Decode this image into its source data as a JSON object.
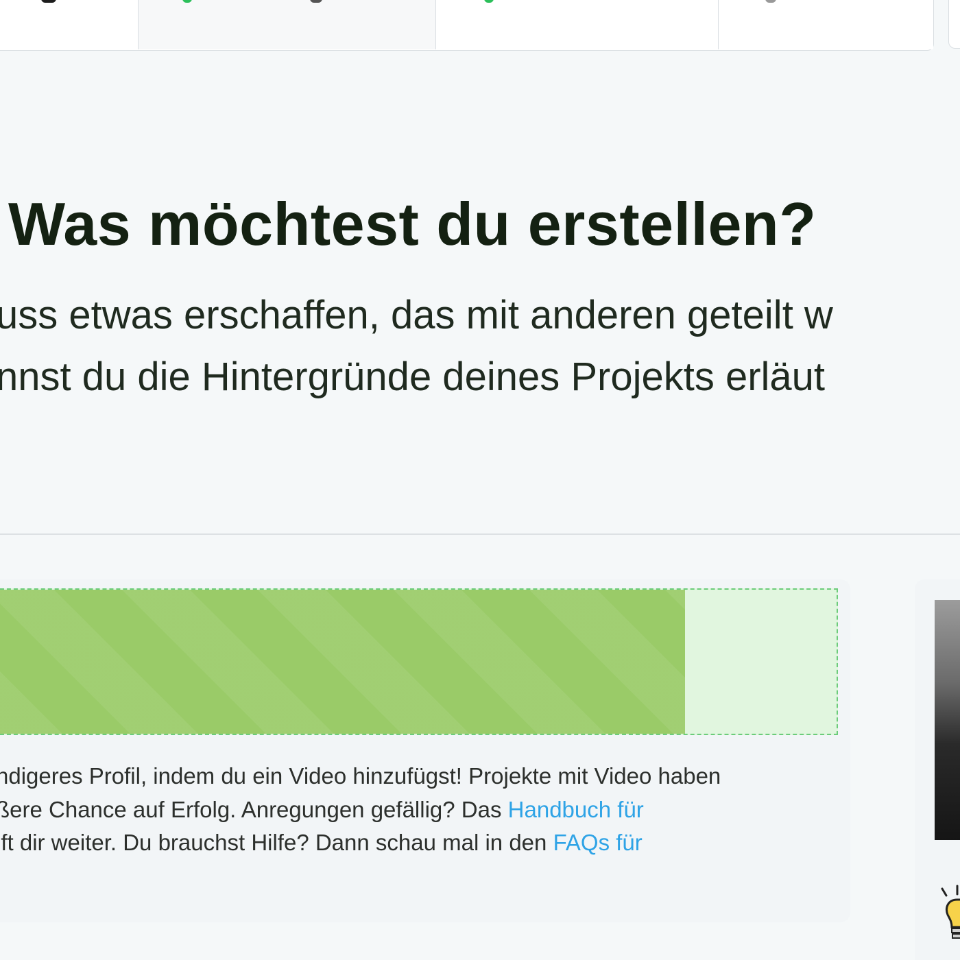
{
  "headline": "Was möchtest du erstellen?",
  "intro": {
    "line1": "uss etwas erschaffen, das mit anderen geteilt w",
    "line2": "nnst du die Hintergründe deines Projekts erläut"
  },
  "progress": {
    "percent": 82
  },
  "tip": {
    "line1": "ndigeres Profil, indem du ein Video hinzufügst! Projekte mit Video haben",
    "line2_prefix": "ßere Chance auf Erfolg. Anregungen gefällig? Das ",
    "line2_link": "Handbuch für",
    "line3_prefix": "lft dir weiter. Du brauchst Hilfe? Dann schau mal in den ",
    "line3_link": "FAQs für"
  },
  "colors": {
    "progress_fill": "#9acb68",
    "progress_track": "#e1f6df",
    "link": "#2ea3e6",
    "heading": "#142112"
  },
  "icons": {
    "bulb": "lightbulb-icon"
  }
}
